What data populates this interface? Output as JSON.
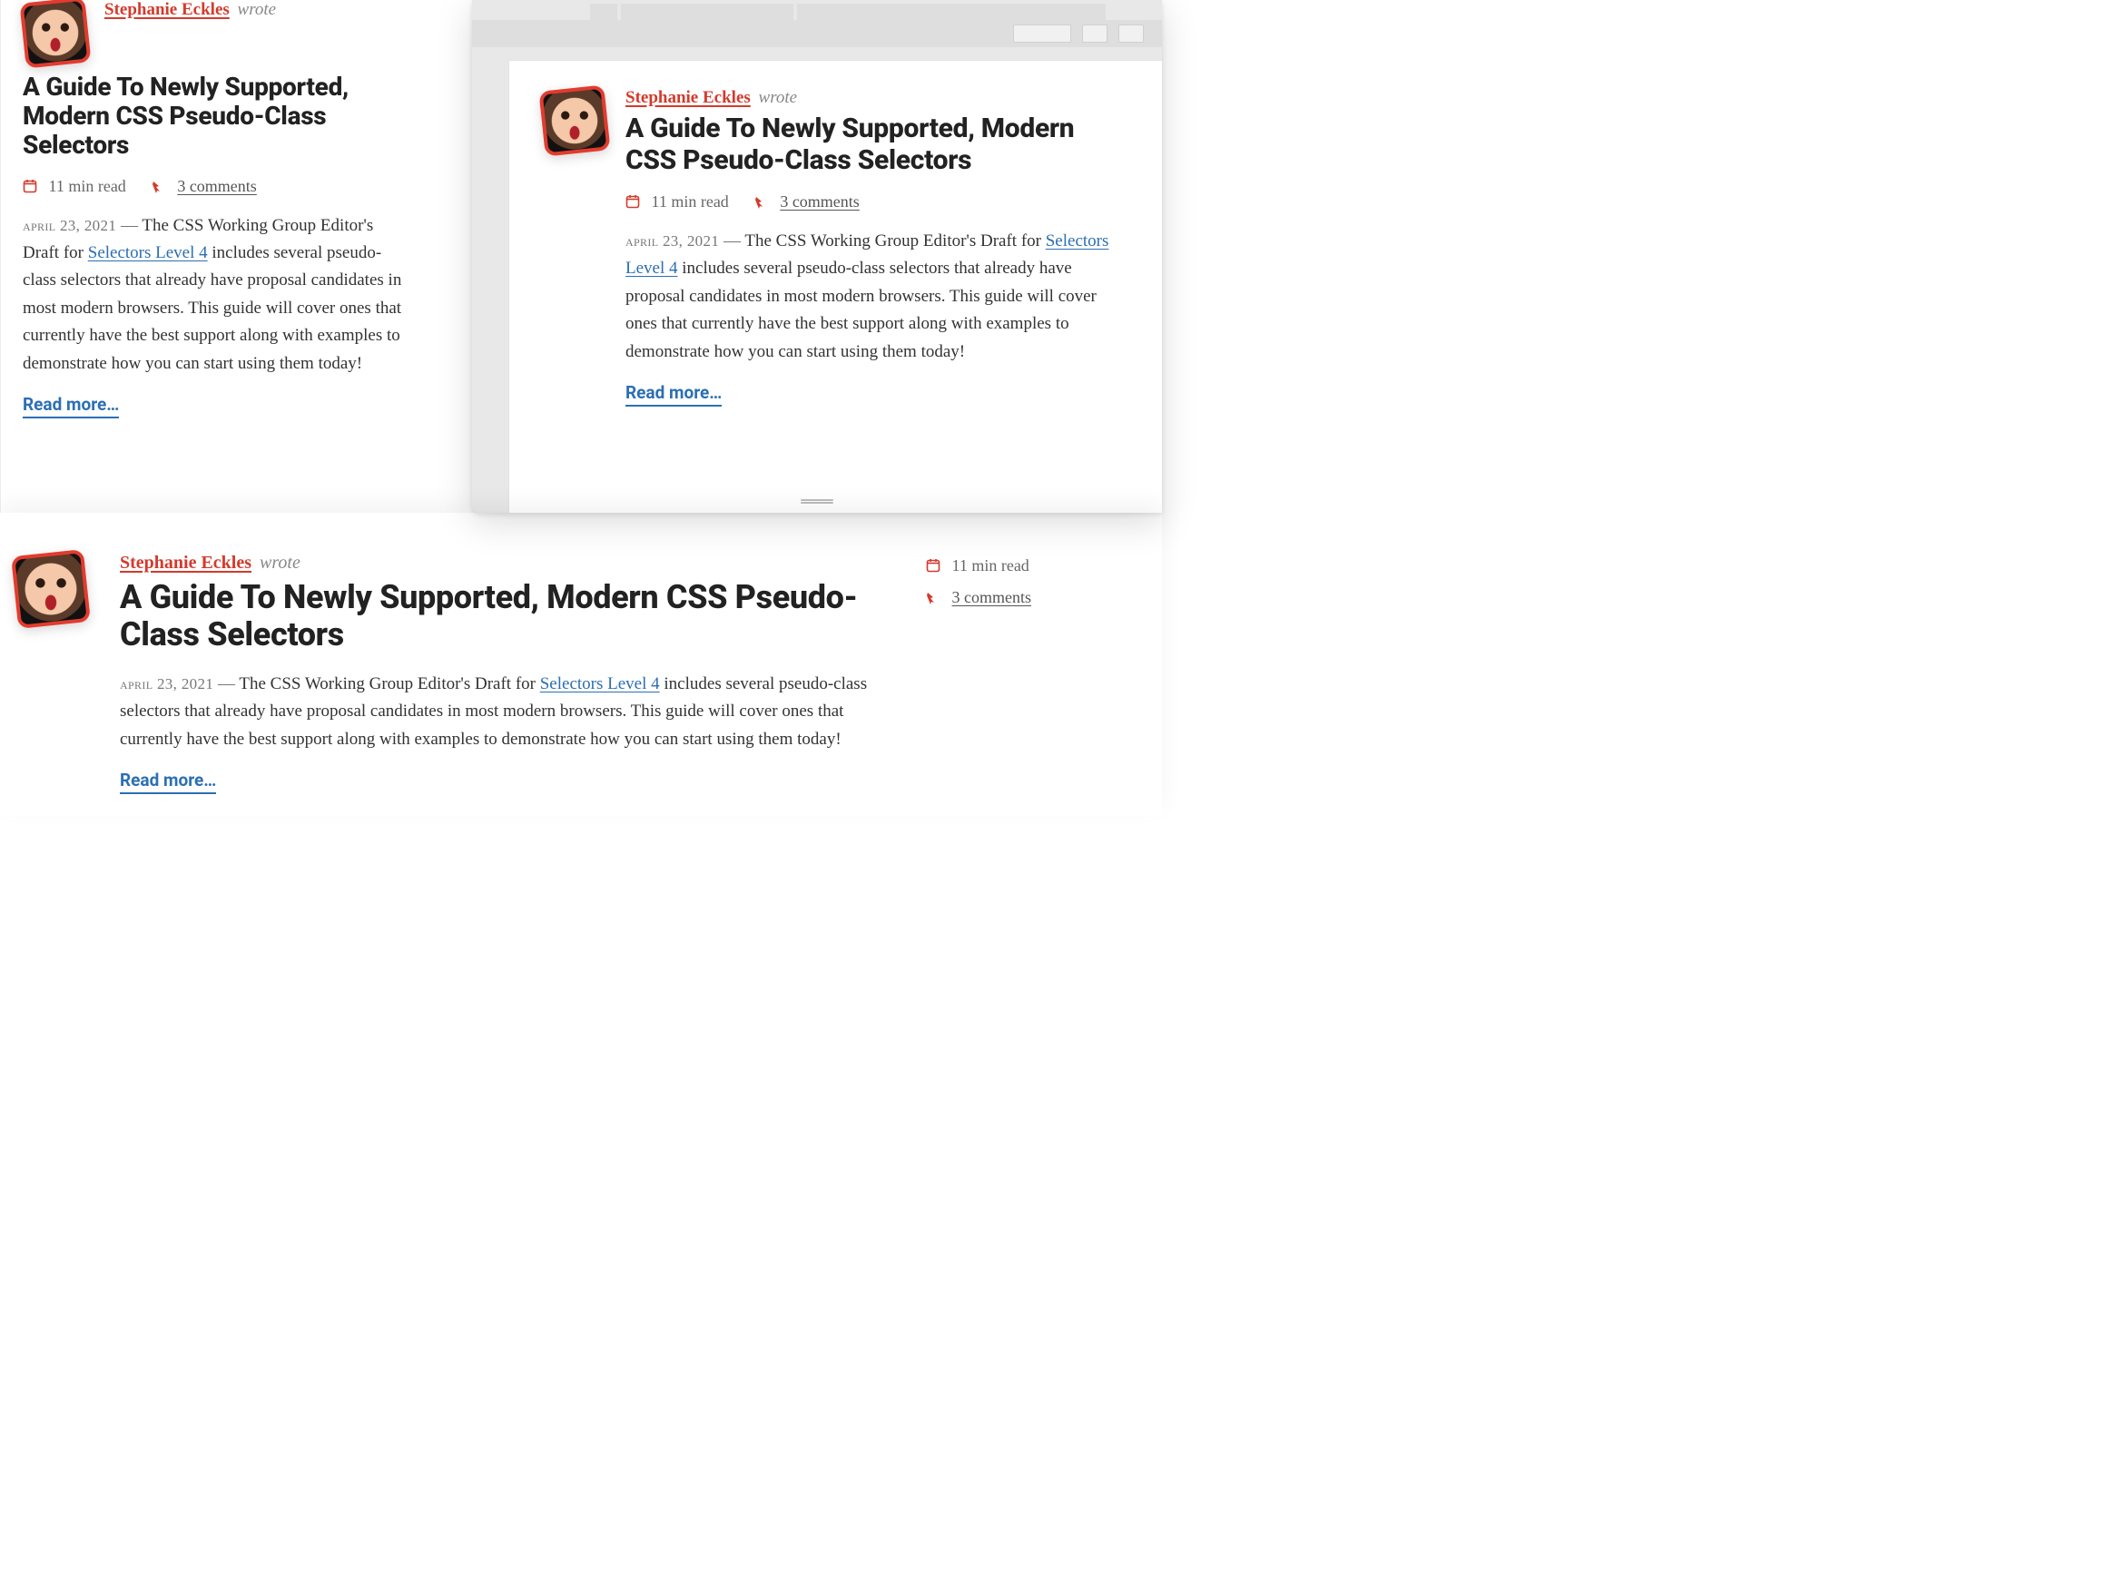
{
  "author": {
    "name": "Stephanie Eckles",
    "wrote": "wrote"
  },
  "title": "A Guide To Newly Supported, Modern CSS Pseudo-Class Selectors",
  "meta": {
    "read_time": "11 min read",
    "comments": "3 comments"
  },
  "excerpt": {
    "date": "april 23, 2021",
    "dash": " — ",
    "pre": "The CSS Working Group Editor's Draft for ",
    "link_text": "Selectors Level 4",
    "post": " includes several pseudo-class selectors that already have proposal candidates in most modern browsers. This guide will cover ones that currently have the best support along with examples to demonstrate how you can start using them today!"
  },
  "readmore": "Read more…",
  "colors": {
    "accent_red": "#d33a2c",
    "link_blue": "#2b6fb3"
  }
}
